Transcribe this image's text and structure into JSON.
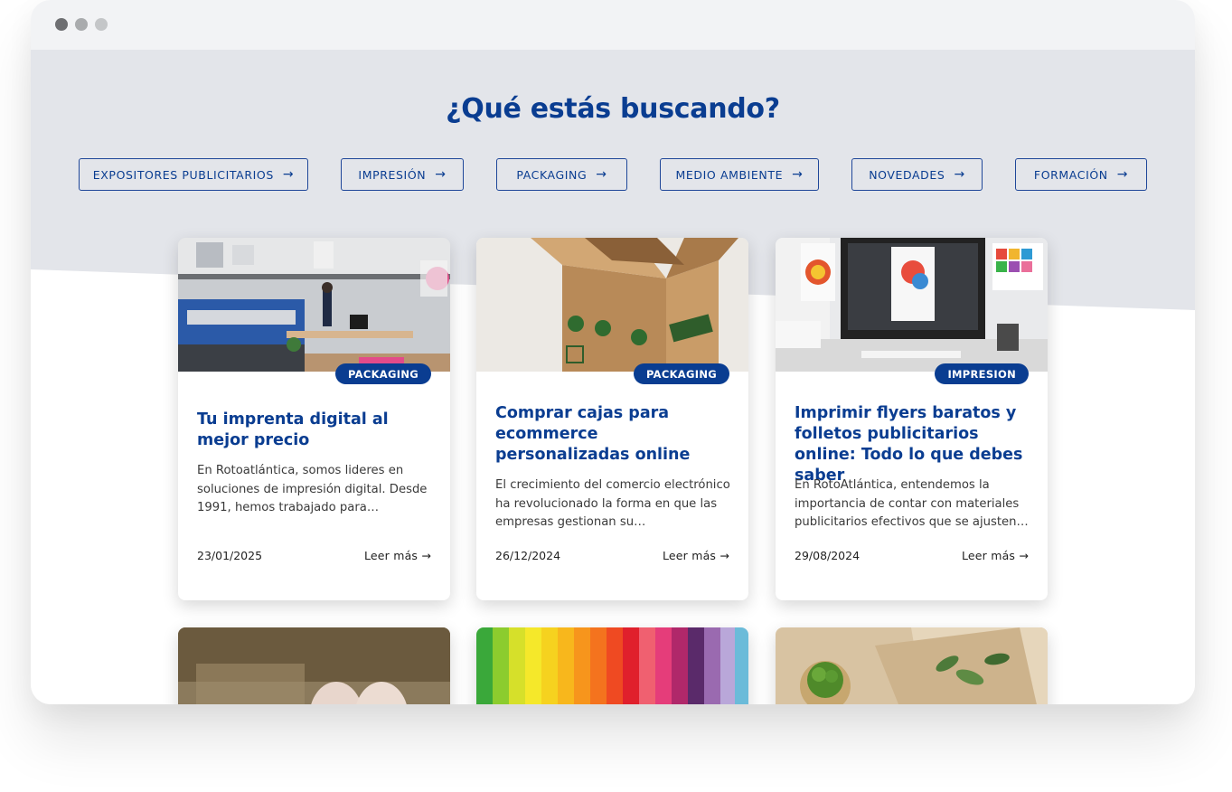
{
  "page": {
    "heading": "¿Qué estás buscando?"
  },
  "categories": [
    {
      "label": "EXPOSITORES PUBLICITARIOS",
      "arrow": "→"
    },
    {
      "label": "IMPRESIÓN",
      "arrow": "→"
    },
    {
      "label": "PACKAGING",
      "arrow": "→"
    },
    {
      "label": "MEDIO AMBIENTE",
      "arrow": "→"
    },
    {
      "label": "NOVEDADES",
      "arrow": "→"
    },
    {
      "label": "FORMACIÓN",
      "arrow": "→"
    }
  ],
  "posts": [
    {
      "badge": "PACKAGING",
      "title": "Tu imprenta digital al mejor precio",
      "excerpt": "En Rotoatlántica, somos lideres en soluciones de impresión digital. Desde 1991, hemos trabajado para…",
      "date": "23/01/2025",
      "more": "Leer más →",
      "image": "printing-press-workshop"
    },
    {
      "badge": "PACKAGING",
      "title": "Comprar cajas para ecommerce personalizadas online",
      "excerpt": "El crecimiento del comercio electrónico ha revolucionado la forma en que las empresas gestionan su…",
      "date": "26/12/2024",
      "more": "Leer más →",
      "image": "eco-cardboard-box"
    },
    {
      "badge": "IMPRESION",
      "title": "Imprimir flyers baratos y folletos publicitarios online: Todo lo que debes saber",
      "excerpt": "En RotoAtlántica, entendemos la importancia de contar con materiales publicitarios efectivos que se ajusten…",
      "date": "29/08/2024",
      "more": "Leer más →",
      "image": "flyer-design-desk"
    }
  ],
  "more_posts_images": [
    "open-book-heart",
    "color-paper-swatches",
    "eco-packaging-plant"
  ],
  "colors": {
    "brand_blue": "#0a3d91",
    "band_gray": "#e3e5ea"
  }
}
